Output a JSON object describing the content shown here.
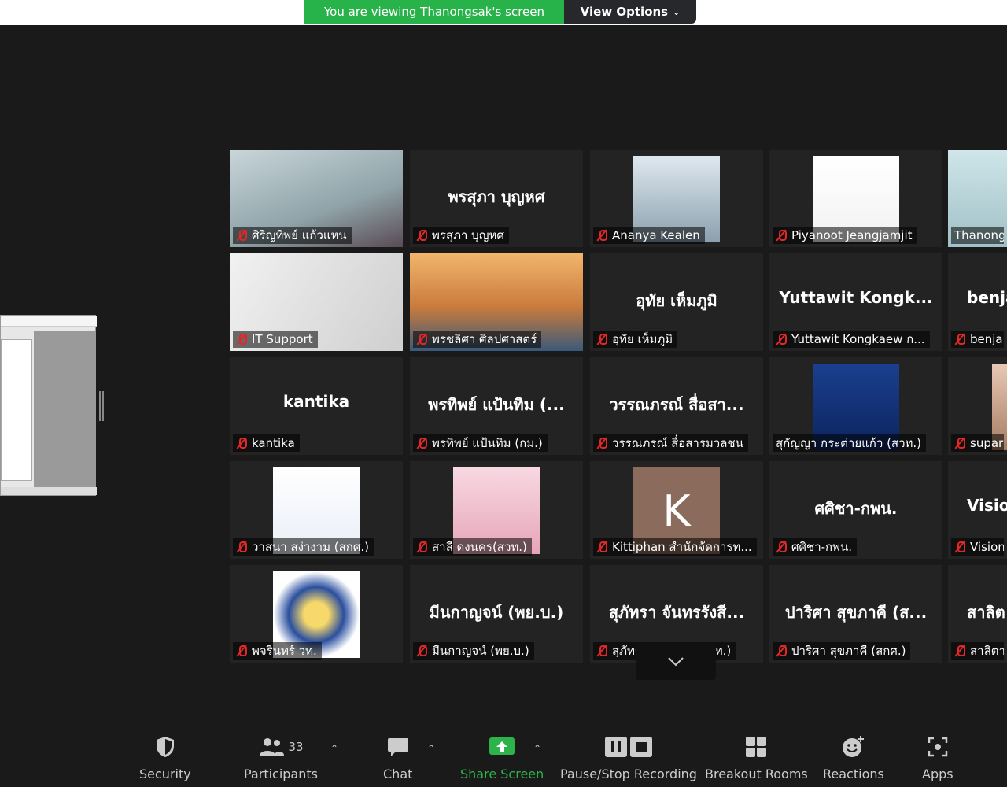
{
  "banner": {
    "viewing_text": "You are viewing Thanongsak's screen",
    "view_options_label": "View Options",
    "colors": {
      "banner": "#28b34a"
    }
  },
  "gallery": {
    "tiles": [
      {
        "name": "ศิริญทิพย์ แก้วแหน",
        "display": "",
        "type": "video"
      },
      {
        "name": "พรสุภา บุญหศ",
        "display": "พรสุภา บุญหศ",
        "type": "name"
      },
      {
        "name": "Ananya Kealen",
        "display": "",
        "type": "photo"
      },
      {
        "name": "Piyanoot Jeangjamjit",
        "display": "",
        "type": "photo"
      },
      {
        "name": "Thanong",
        "display": "",
        "type": "video-active"
      },
      {
        "name": "IT Support",
        "display": "",
        "type": "video"
      },
      {
        "name": "พรชลิศา ศิลปศาสตร์",
        "display": "",
        "type": "video"
      },
      {
        "name": "อุทัย เห็มภูมิ",
        "display": "อุทัย เห็มภูมิ",
        "type": "name"
      },
      {
        "name": "Yuttawit Kongkaew ก...",
        "display": "Yuttawit  Kongk...",
        "type": "name"
      },
      {
        "name": "benja",
        "display": "benja",
        "type": "name"
      },
      {
        "name": "kantika",
        "display": "kantika",
        "type": "name"
      },
      {
        "name": "พรทิพย์ แป้นทิม (กม.)",
        "display": "พรทิพย์ แป้นทิม (...",
        "type": "name"
      },
      {
        "name": "วรรณภรณ์ สื่อสารมวลชน",
        "display": "วรรณภรณ์ สื่อสา...",
        "type": "name"
      },
      {
        "name": "สุกัญญา กระต่ายแก้ว (สวท.)",
        "display": "",
        "type": "photo"
      },
      {
        "name": "supar",
        "display": "",
        "type": "photo"
      },
      {
        "name": "วาสนา สง่างาม (สกศ.)",
        "display": "",
        "type": "photo"
      },
      {
        "name": "สาลี ดงนคร(สวท.)",
        "display": "",
        "type": "photo"
      },
      {
        "name": "Kittiphan สำนักจัดการท...",
        "display": "",
        "type": "avatar",
        "avatar_letter": "K"
      },
      {
        "name": "ศศิชา-กพน.",
        "display": "ศศิชา-กพน.",
        "type": "name"
      },
      {
        "name": "Vision",
        "display": "Visio",
        "type": "name"
      },
      {
        "name": "พจรินทร์ วท.",
        "display": "",
        "type": "photo"
      },
      {
        "name": "มีนกาญจน์ (พย.บ.)",
        "display": "มีนกาญจน์ (พย.บ.)",
        "type": "name"
      },
      {
        "name": "สุภัทรา จันทรรังสี (วท.)",
        "display": "สุภัทรา จันทรรังสี...",
        "type": "name"
      },
      {
        "name": "ปาริศา สุขภาคี (สกศ.)",
        "display": "ปาริศา สุขภาคี (ส...",
        "type": "name"
      },
      {
        "name": "สาลิตา",
        "display": "สาลิต",
        "type": "name"
      }
    ]
  },
  "toolbar": {
    "security": "Security",
    "participants": "Participants",
    "participants_count": "33",
    "chat": "Chat",
    "share_screen": "Share Screen",
    "recording": "Pause/Stop Recording",
    "breakout": "Breakout Rooms",
    "reactions": "Reactions",
    "apps": "Apps",
    "colors": {
      "share": "#2db34a"
    }
  }
}
